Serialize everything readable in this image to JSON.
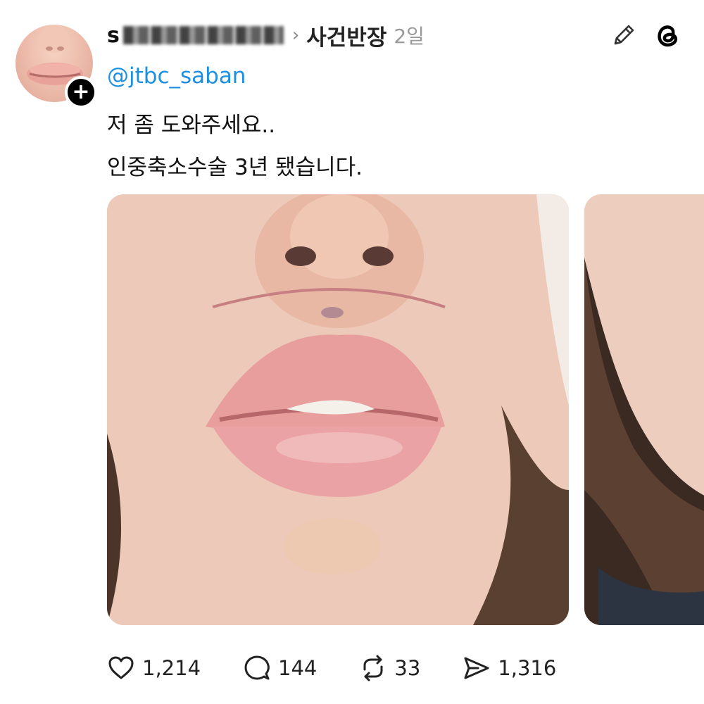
{
  "post": {
    "username_visible_prefix": "s",
    "community": "사건반장",
    "time": "2일",
    "mention": "@jtbc_saban",
    "text_lines": [
      "저 좀 도와주세요..",
      "인중축소수술 3년 됐습니다."
    ]
  },
  "icons": {
    "follow": "plus-icon",
    "edit": "pencil-icon",
    "app": "threads-logo-icon",
    "like": "heart-icon",
    "reply": "speech-bubble-icon",
    "repost": "repost-icon",
    "share": "send-icon"
  },
  "follow_symbol": "+",
  "actions": {
    "likes": "1,214",
    "replies": "144",
    "reposts": "33",
    "shares": "1,316"
  },
  "colors": {
    "mention": "#1d8fe1",
    "text": "#111111",
    "muted": "#999999"
  }
}
